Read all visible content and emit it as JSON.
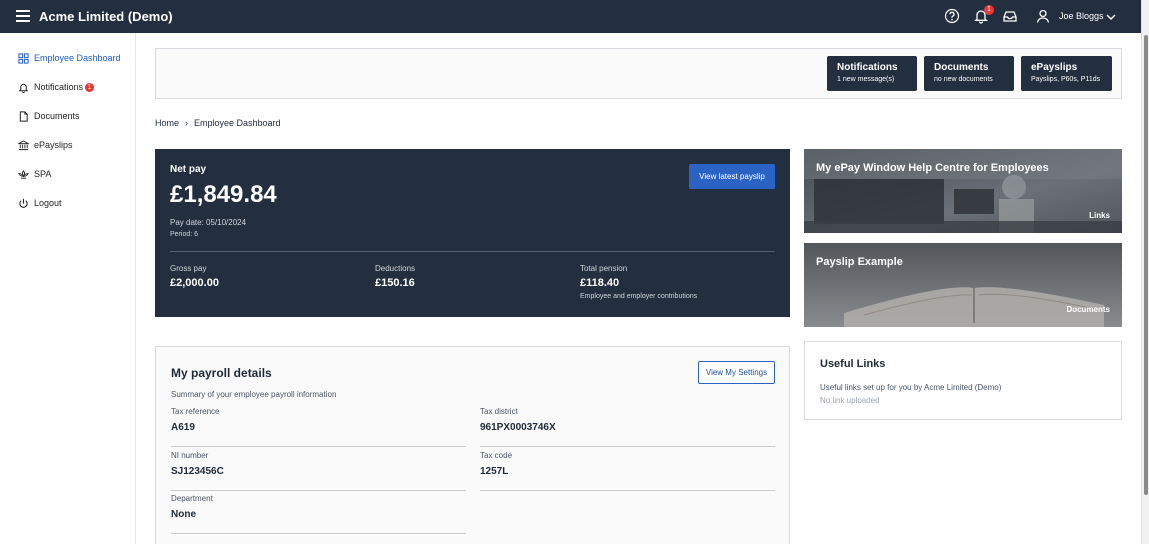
{
  "header": {
    "app_title": "Acme Limited (Demo)",
    "notification_count": "1",
    "user_name": "Joe Bloggs"
  },
  "sidebar": {
    "items": [
      {
        "label": "Employee Dashboard",
        "icon": "dashboard-icon",
        "active": true
      },
      {
        "label": "Notifications",
        "icon": "bell-icon",
        "badge": "1"
      },
      {
        "label": "Documents",
        "icon": "document-icon"
      },
      {
        "label": "ePayslips",
        "icon": "bank-icon"
      },
      {
        "label": "SPA",
        "icon": "lotus-icon"
      },
      {
        "label": "Logout",
        "icon": "power-icon"
      }
    ]
  },
  "quick_links": [
    {
      "title": "Notifications",
      "subtitle": "1 new message(s)"
    },
    {
      "title": "Documents",
      "subtitle": "no new documents"
    },
    {
      "title": "ePayslips",
      "subtitle": "Payslips, P60s, P11ds"
    }
  ],
  "breadcrumb": {
    "home": "Home",
    "current": "Employee Dashboard"
  },
  "net_pay": {
    "label": "Net pay",
    "amount": "£1,849.84",
    "pay_date": "Pay date: 05/10/2024",
    "period": "Period: 6",
    "button": "View latest payslip",
    "gross_label": "Gross pay",
    "gross_value": "£2,000.00",
    "deductions_label": "Deductions",
    "deductions_value": "£150.16",
    "pension_label": "Total pension",
    "pension_value": "£118.40",
    "pension_note": "Employee and employer contributions"
  },
  "tiles": [
    {
      "title": "My ePay Window Help Centre for Employees",
      "tag": "Links"
    },
    {
      "title": "Payslip Example",
      "tag": "Documents"
    }
  ],
  "payroll": {
    "title": "My payroll details",
    "subtitle": "Summary of your employee payroll information",
    "button": "View My Settings",
    "fields": [
      {
        "label": "Tax reference",
        "value": "A619"
      },
      {
        "label": "Tax district",
        "value": "961PX0003746X"
      },
      {
        "label": "NI number",
        "value": "SJ123456C"
      },
      {
        "label": "Tax code",
        "value": "1257L"
      },
      {
        "label": "Department",
        "value": "None"
      }
    ]
  },
  "useful_links": {
    "title": "Useful Links",
    "subtitle": "Useful links set up for you by Acme Limited (Demo)",
    "empty": "No link uploaded"
  },
  "colors": {
    "navy": "#232f3e",
    "accent_blue": "#2b63c4",
    "badge_red": "#e53935"
  }
}
